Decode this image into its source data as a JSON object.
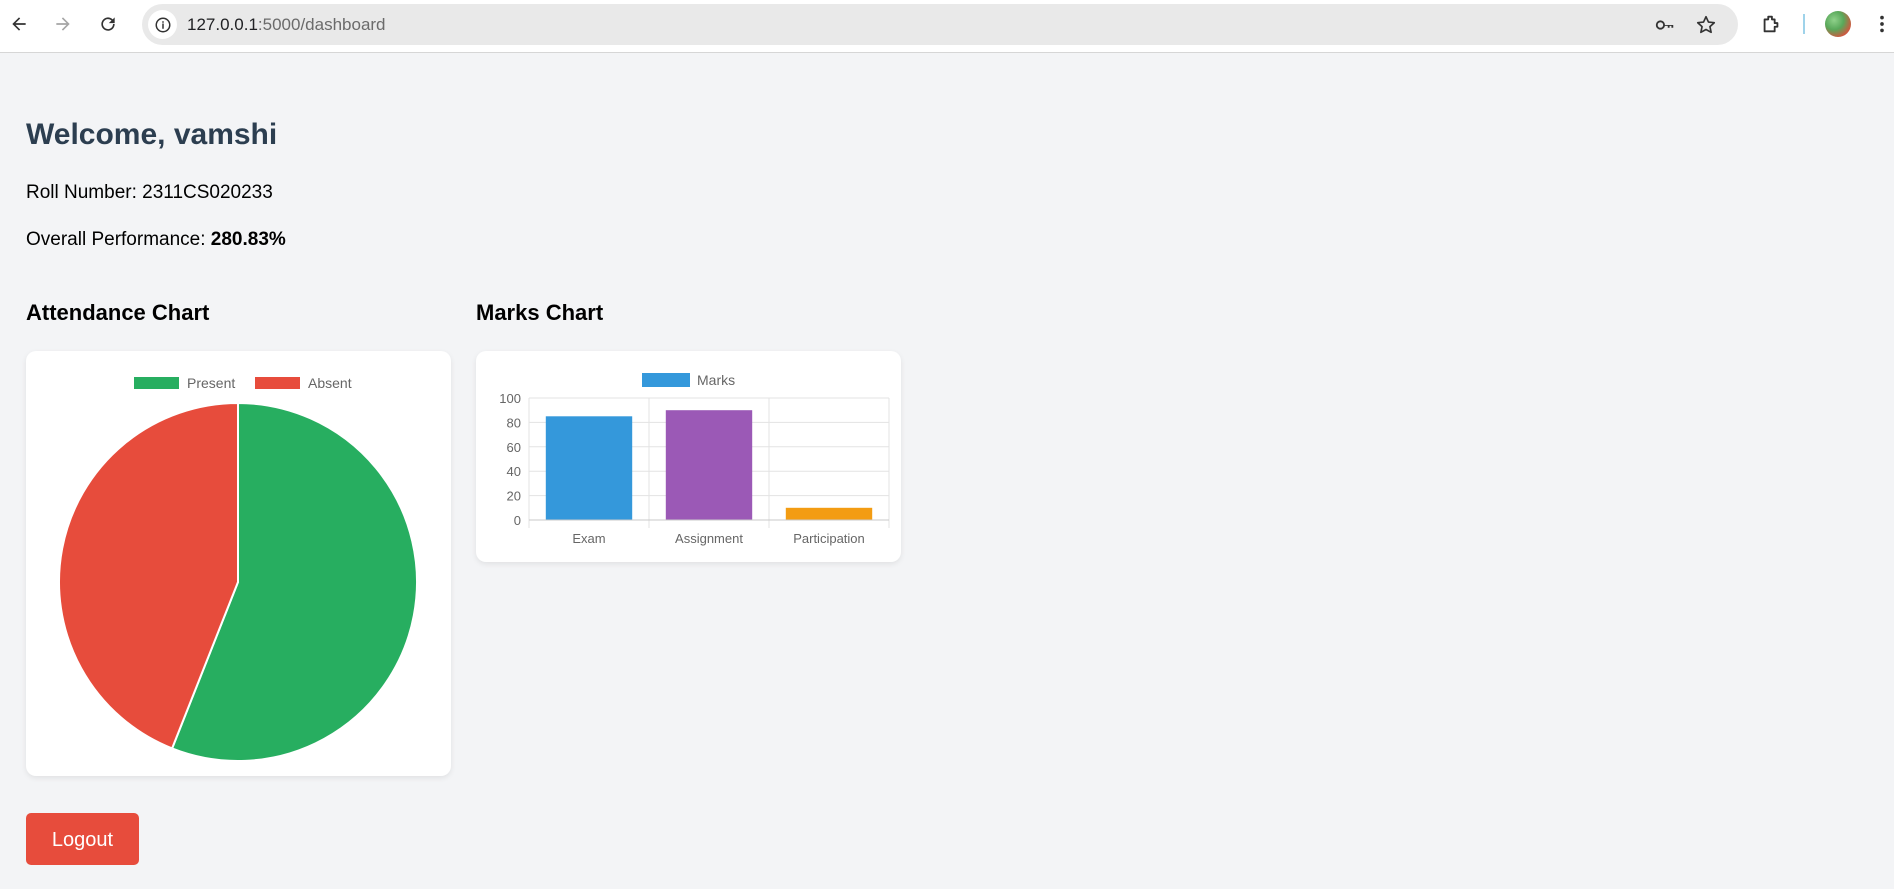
{
  "browser": {
    "url_host": "127.0.0.1",
    "url_rest": ":5000/dashboard"
  },
  "page": {
    "welcome": "Welcome, vamshi",
    "roll_label": "Roll Number: ",
    "roll_value": "2311CS020233",
    "performance_label": "Overall Performance: ",
    "performance_value": "280.83%",
    "attendance_title": "Attendance Chart",
    "marks_title": "Marks Chart",
    "logout_label": "Logout"
  },
  "colors": {
    "present": "#27ae60",
    "absent": "#e74c3c",
    "exam": "#3498db",
    "assignment": "#9b59b6",
    "participation": "#f39c12",
    "logout": "#e74c3c"
  },
  "chart_data": [
    {
      "type": "pie",
      "legend": [
        "Present",
        "Absent"
      ],
      "values": [
        56,
        44
      ],
      "colors": [
        "#27ae60",
        "#e74c3c"
      ],
      "legend_position": "top"
    },
    {
      "type": "bar",
      "legend": [
        "Marks"
      ],
      "categories": [
        "Exam",
        "Assignment",
        "Participation"
      ],
      "series": [
        {
          "name": "Marks",
          "values": [
            85,
            90,
            10
          ]
        }
      ],
      "colors": [
        "#3498db",
        "#9b59b6",
        "#f39c12"
      ],
      "ylim": [
        0,
        100
      ],
      "yticks": [
        0,
        20,
        40,
        60,
        80,
        100
      ],
      "grid": true,
      "legend_position": "top"
    }
  ]
}
